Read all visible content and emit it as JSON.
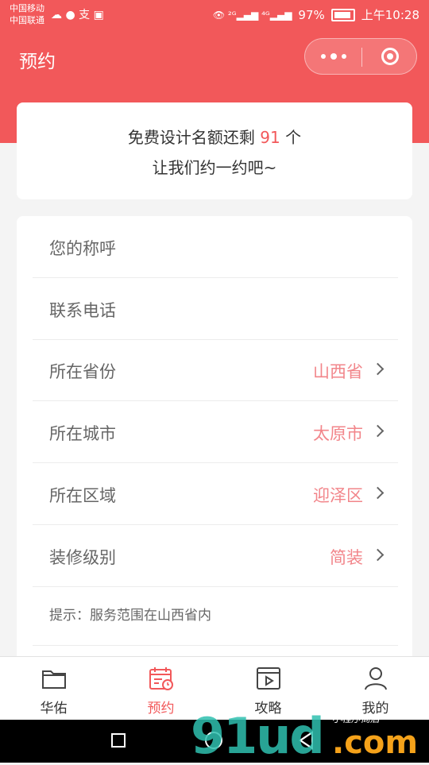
{
  "status_bar": {
    "carrier_1": "中国移动",
    "carrier_2": "中国联通",
    "left_icons": "☁ ● 支 ▣",
    "signal": "👁 ²ᴳ▂▄▆ ⁴ᴳ▂▄▆",
    "battery_percent": "97%",
    "time": "上午10:28"
  },
  "nav": {
    "title": "预约"
  },
  "promo": {
    "text_before": "免费设计名额还剩",
    "count": "91",
    "text_after": "个",
    "line2": "让我们约一约吧~"
  },
  "form": {
    "fields": [
      {
        "label": "您的称呼",
        "value": ""
      },
      {
        "label": "联系电话",
        "value": ""
      },
      {
        "label": "所在省份",
        "value": "山西省"
      },
      {
        "label": "所在城市",
        "value": "太原市"
      },
      {
        "label": "所在区域",
        "value": "迎泽区"
      },
      {
        "label": "装修级别",
        "value": "简装"
      }
    ],
    "hint": "提示：服务范围在山西省内"
  },
  "tabbar": {
    "tabs": [
      {
        "label": "华佑",
        "icon": "folder-icon"
      },
      {
        "label": "预约",
        "icon": "calendar-icon"
      },
      {
        "label": "攻略",
        "icon": "video-icon"
      },
      {
        "label": "我的",
        "icon": "user-icon"
      }
    ],
    "active_color": "#f2585a"
  },
  "watermark": {
    "text_main": "91ud",
    "text_suffix": ".com",
    "text_small": "小程序商店"
  },
  "colors": {
    "brand": "#f2585a",
    "value_text": "#f2858a"
  }
}
